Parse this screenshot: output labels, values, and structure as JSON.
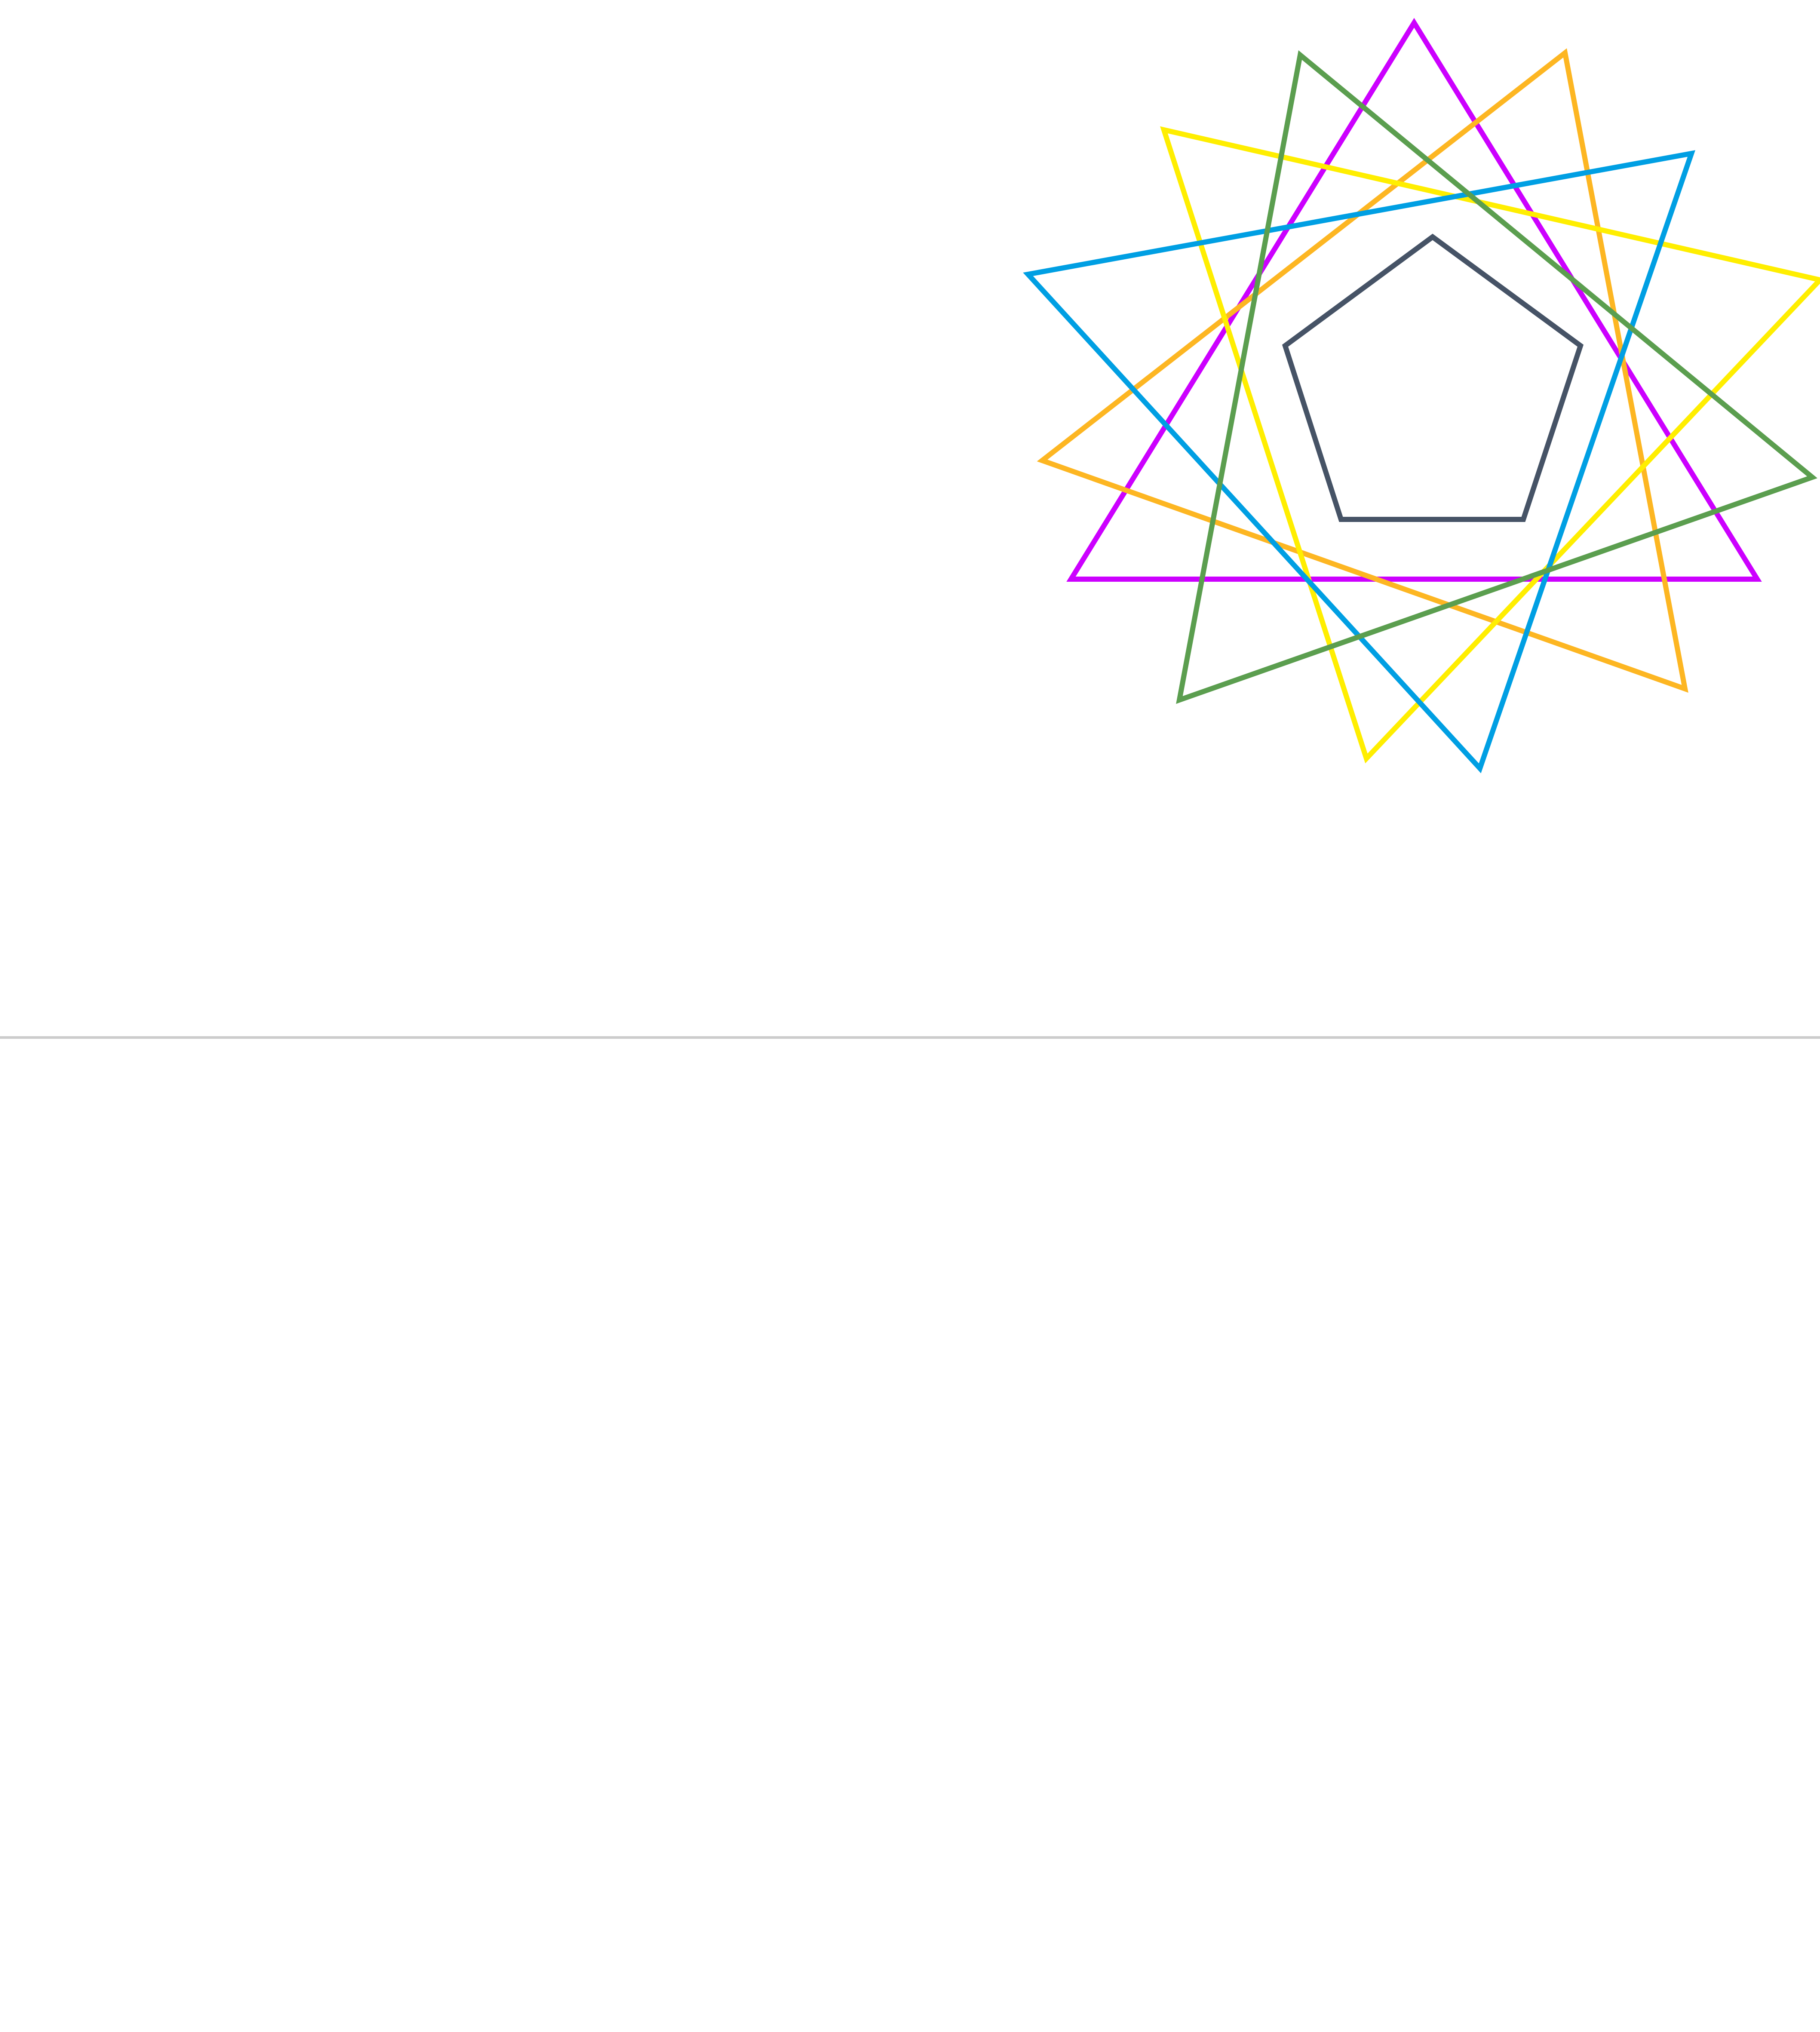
{
  "canvas": {
    "background": "#ffffff"
  },
  "figure": {
    "description_shapes": [
      {
        "kind": "triangle",
        "color": "#cc00ff"
      },
      {
        "kind": "triangle",
        "color": "#5b9e4f"
      },
      {
        "kind": "triangle",
        "color": "#fdb622"
      },
      {
        "kind": "triangle",
        "color": "#ffee00"
      },
      {
        "kind": "triangle",
        "color": "#009fe3"
      },
      {
        "kind": "pentagon",
        "color": "#465366"
      }
    ]
  },
  "divider": {
    "color": "#cccccc"
  }
}
